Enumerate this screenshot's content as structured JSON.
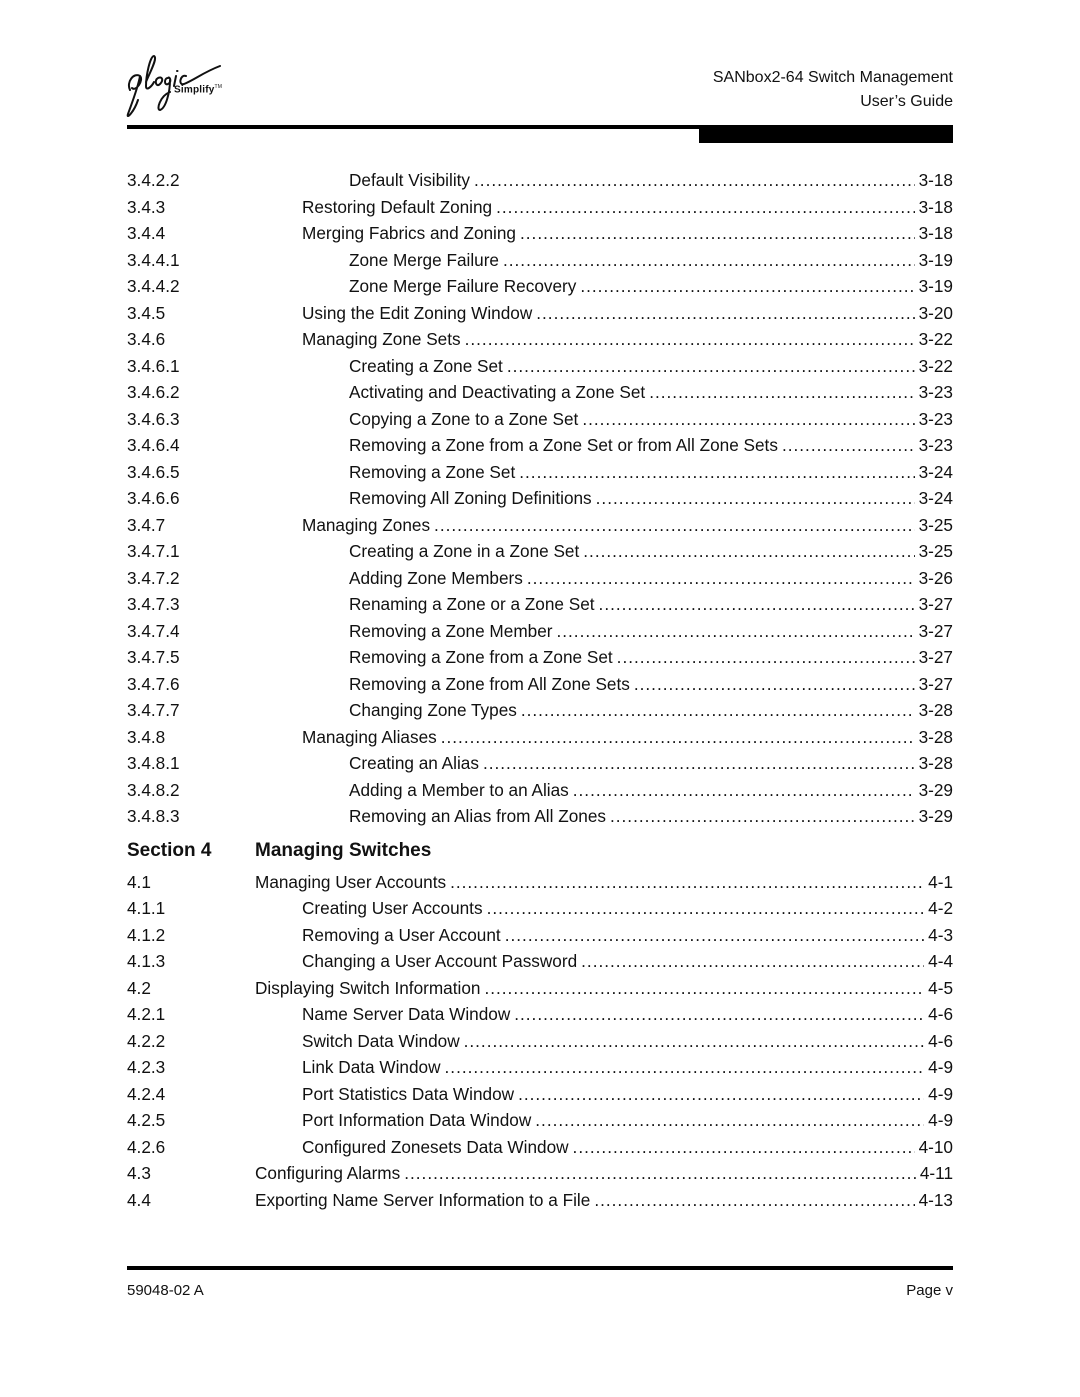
{
  "header": {
    "logo_brand": "qlogic",
    "logo_tagline": "Simplify",
    "logo_tm": "TM",
    "title_line1": "SANbox2-64 Switch Management",
    "title_line2": "User’s Guide"
  },
  "toc_part1": [
    {
      "num": "3.4.2.2",
      "title": "Default Visibility",
      "page": "3-18",
      "level": "b"
    },
    {
      "num": "3.4.3",
      "title": "Restoring Default Zoning",
      "page": "3-18",
      "level": "a"
    },
    {
      "num": "3.4.4",
      "title": "Merging Fabrics and Zoning",
      "page": "3-18",
      "level": "a"
    },
    {
      "num": "3.4.4.1",
      "title": "Zone Merge Failure",
      "page": "3-19",
      "level": "b"
    },
    {
      "num": "3.4.4.2",
      "title": "Zone Merge Failure Recovery",
      "page": "3-19",
      "level": "b"
    },
    {
      "num": "3.4.5",
      "title": "Using the Edit Zoning Window",
      "page": "3-20",
      "level": "a"
    },
    {
      "num": "3.4.6",
      "title": "Managing Zone Sets",
      "page": "3-22",
      "level": "a"
    },
    {
      "num": "3.4.6.1",
      "title": "Creating a Zone Set",
      "page": "3-22",
      "level": "b"
    },
    {
      "num": "3.4.6.2",
      "title": "Activating and Deactivating a Zone Set",
      "page": "3-23",
      "level": "b"
    },
    {
      "num": "3.4.6.3",
      "title": "Copying a Zone to a Zone Set",
      "page": "3-23",
      "level": "b"
    },
    {
      "num": "3.4.6.4",
      "title": "Removing a Zone from a Zone Set or from All Zone Sets",
      "page": "3-23",
      "level": "b"
    },
    {
      "num": "3.4.6.5",
      "title": "Removing a Zone Set",
      "page": "3-24",
      "level": "b"
    },
    {
      "num": "3.4.6.6",
      "title": "Removing All Zoning Definitions",
      "page": "3-24",
      "level": "b"
    },
    {
      "num": "3.4.7",
      "title": "Managing Zones",
      "page": "3-25",
      "level": "a"
    },
    {
      "num": "3.4.7.1",
      "title": "Creating a Zone in a Zone Set",
      "page": "3-25",
      "level": "b"
    },
    {
      "num": "3.4.7.2",
      "title": "Adding Zone Members",
      "page": "3-26",
      "level": "b"
    },
    {
      "num": "3.4.7.3",
      "title": "Renaming a Zone or a Zone Set",
      "page": "3-27",
      "level": "b"
    },
    {
      "num": "3.4.7.4",
      "title": "Removing a Zone Member",
      "page": "3-27",
      "level": "b"
    },
    {
      "num": "3.4.7.5",
      "title": "Removing a Zone from a Zone Set",
      "page": "3-27",
      "level": "b"
    },
    {
      "num": "3.4.7.6",
      "title": "Removing a Zone from All Zone Sets",
      "page": "3-27",
      "level": "b"
    },
    {
      "num": "3.4.7.7",
      "title": "Changing Zone Types",
      "page": "3-28",
      "level": "b"
    },
    {
      "num": "3.4.8",
      "title": "Managing Aliases",
      "page": "3-28",
      "level": "a"
    },
    {
      "num": "3.4.8.1",
      "title": "Creating an Alias",
      "page": "3-28",
      "level": "b"
    },
    {
      "num": "3.4.8.2",
      "title": "Adding a Member to an Alias",
      "page": "3-29",
      "level": "b"
    },
    {
      "num": "3.4.8.3",
      "title": "Removing an Alias from All Zones",
      "page": "3-29",
      "level": "b"
    }
  ],
  "section": {
    "label": "Section 4",
    "title": "Managing Switches"
  },
  "toc_part2": [
    {
      "num": "4.1",
      "title": "Managing User Accounts",
      "page": "4-1",
      "level": "c"
    },
    {
      "num": "4.1.1",
      "title": "Creating User Accounts",
      "page": "4-2",
      "level": "a"
    },
    {
      "num": "4.1.2",
      "title": "Removing a User Account",
      "page": "4-3",
      "level": "a"
    },
    {
      "num": "4.1.3",
      "title": "Changing a User Account Password",
      "page": "4-4",
      "level": "a"
    },
    {
      "num": "4.2",
      "title": "Displaying Switch Information",
      "page": "4-5",
      "level": "c"
    },
    {
      "num": "4.2.1",
      "title": "Name Server Data Window",
      "page": "4-6",
      "level": "a"
    },
    {
      "num": "4.2.2",
      "title": "Switch Data Window",
      "page": "4-6",
      "level": "a"
    },
    {
      "num": "4.2.3",
      "title": "Link Data Window",
      "page": "4-9",
      "level": "a"
    },
    {
      "num": "4.2.4",
      "title": "Port Statistics Data Window",
      "page": "4-9",
      "level": "a"
    },
    {
      "num": "4.2.5",
      "title": "Port Information Data Window",
      "page": "4-9",
      "level": "a"
    },
    {
      "num": "4.2.6",
      "title": "Configured Zonesets Data Window",
      "page": "4-10",
      "level": "a"
    },
    {
      "num": "4.3",
      "title": "Configuring Alarms",
      "page": "4-11",
      "level": "c"
    },
    {
      "num": "4.4",
      "title": "Exporting Name Server Information to a File",
      "page": "4-13",
      "level": "c"
    }
  ],
  "footer": {
    "doc_number": "59048-02  A",
    "page_label": "Page v"
  }
}
